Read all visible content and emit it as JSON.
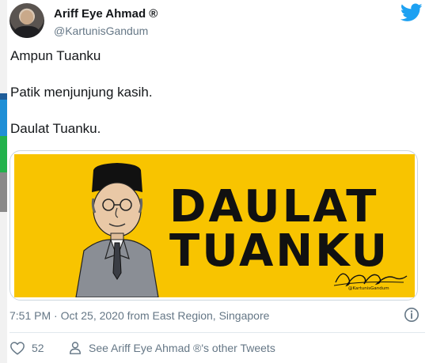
{
  "author": {
    "display_name": "Ariff Eye Ahmad ®",
    "handle": "@KartunisGandum"
  },
  "tweet": {
    "lines": [
      "Ampun Tuanku",
      "Patik menjunjung kasih.",
      "Daulat Tuanku."
    ],
    "timestamp": "7:51 PM · Oct 25, 2020 from East Region, Singapore"
  },
  "media": {
    "headline_line1": "DAULAT",
    "headline_line2": "TUANKU",
    "signature_tag": "@KartunisGandum",
    "background_color": "#f8c400"
  },
  "actions": {
    "like_count": "52",
    "other_tweets_label": "See Ariff Eye Ahmad ®'s other Tweets"
  },
  "icons": {
    "brand": "twitter-bird-icon",
    "info": "info-icon",
    "like": "heart-icon",
    "profile": "person-icon"
  },
  "colors": {
    "twitter_blue": "#1da1f2",
    "secondary_text": "#657786",
    "border": "#ccd6dd"
  }
}
